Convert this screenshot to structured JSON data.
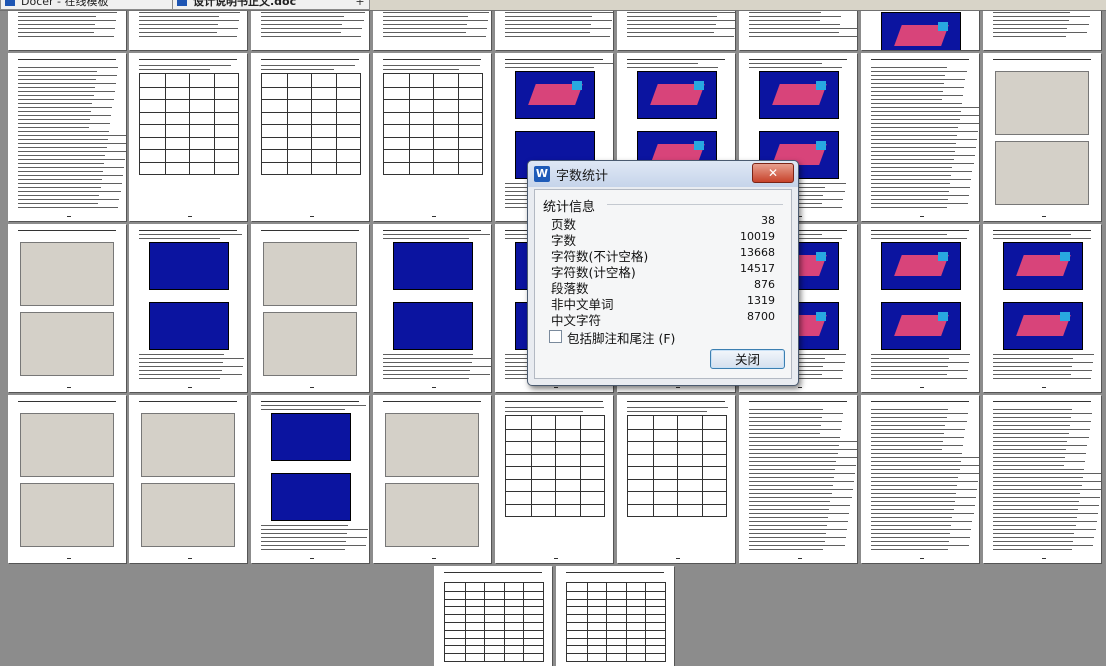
{
  "tabs": [
    {
      "label": "Docer - 在线模板"
    },
    {
      "label": "设计说明书正文.doc"
    }
  ],
  "dialog": {
    "title": "字数统计",
    "section": "统计信息",
    "stats": [
      {
        "label": "页数",
        "value": "38"
      },
      {
        "label": "字数",
        "value": "10019"
      },
      {
        "label": "字符数(不计空格)",
        "value": "13668"
      },
      {
        "label": "字符数(计空格)",
        "value": "14517"
      },
      {
        "label": "段落数",
        "value": "876"
      },
      {
        "label": "非中文单词",
        "value": "1319"
      },
      {
        "label": "中文字符",
        "value": "8700"
      }
    ],
    "include_footnotes": "包括脚注和尾注 (F)",
    "close_button": "关闭"
  },
  "colors": {
    "accent": "#1e5bb8",
    "page_background": "#8c8c8c",
    "model_background": "#0b14a0"
  }
}
